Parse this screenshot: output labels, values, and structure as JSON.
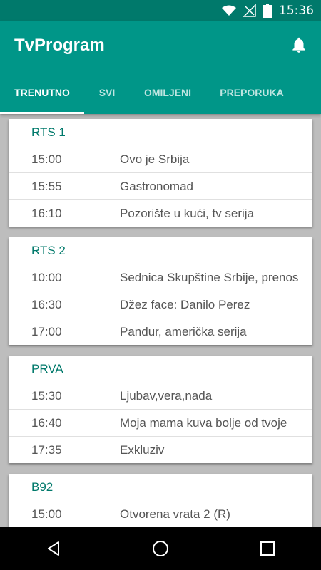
{
  "status_bar": {
    "time": "15:36"
  },
  "app_bar": {
    "title": "TvProgram"
  },
  "tabs": [
    {
      "label": "TRENUTNO"
    },
    {
      "label": "SVI"
    },
    {
      "label": "OMILJENI"
    },
    {
      "label": "PREPORUKA"
    }
  ],
  "channels": [
    {
      "name": "RTS 1",
      "programs": [
        {
          "time": "15:00",
          "title": "Ovo je Srbija"
        },
        {
          "time": "15:55",
          "title": "Gastronomad"
        },
        {
          "time": "16:10",
          "title": "Pozorište u kući, tv serija"
        }
      ]
    },
    {
      "name": "RTS 2",
      "programs": [
        {
          "time": "10:00",
          "title": "Sednica Skupštine Srbije, prenos"
        },
        {
          "time": "16:30",
          "title": "Džez face: Danilo Perez"
        },
        {
          "time": "17:00",
          "title": "Pandur, američka serija"
        }
      ]
    },
    {
      "name": "PRVA",
      "programs": [
        {
          "time": "15:30",
          "title": "Ljubav,vera,nada"
        },
        {
          "time": "16:40",
          "title": "Moja mama kuva bolje od tvoje"
        },
        {
          "time": "17:35",
          "title": "Exkluziv"
        }
      ]
    },
    {
      "name": "B92",
      "programs": [
        {
          "time": "15:00",
          "title": "Otvorena vrata 2 (R)"
        }
      ]
    }
  ],
  "colors": {
    "primary": "#009688",
    "primary_dark": "#00796b",
    "channel_name": "#00796b"
  }
}
